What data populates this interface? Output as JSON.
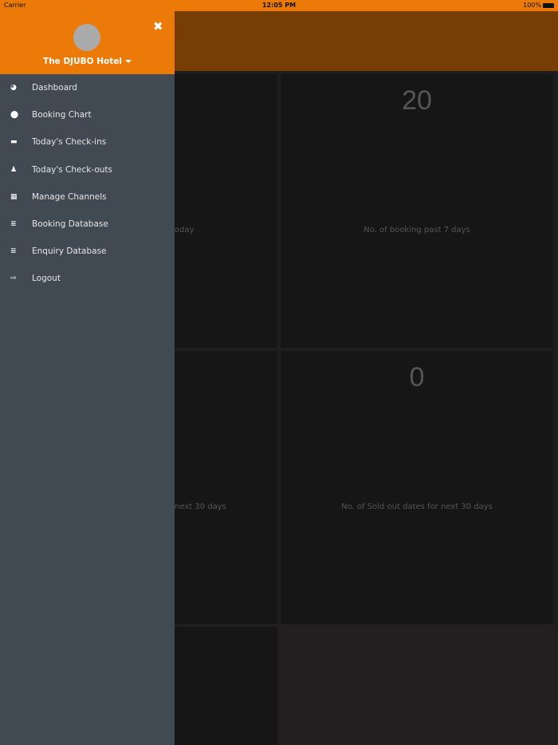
{
  "status_bar": {
    "carrier": "Carrier",
    "time": "12:05 PM",
    "battery": "100%"
  },
  "drawer": {
    "hotel_name": "The DJUBO Hotel",
    "menu": [
      {
        "label": "Dashboard",
        "icon": "dashboard-icon",
        "glyph": "◕"
      },
      {
        "label": "Booking Chart",
        "icon": "map-marker-icon",
        "glyph": "⬤"
      },
      {
        "label": "Today's Check-ins",
        "icon": "bed-icon",
        "glyph": "▬"
      },
      {
        "label": "Today's Check-outs",
        "icon": "person-icon",
        "glyph": "♟"
      },
      {
        "label": "Manage Channels",
        "icon": "grid-icon",
        "glyph": "▦"
      },
      {
        "label": "Booking Database",
        "icon": "database-icon",
        "glyph": "≣"
      },
      {
        "label": "Enquiry Database",
        "icon": "database-icon",
        "glyph": "≣"
      },
      {
        "label": "Logout",
        "icon": "sign-out-icon",
        "glyph": "⇨"
      }
    ]
  },
  "dashboard": {
    "cards": [
      {
        "value": "20",
        "label": "No. of booking past 7 days"
      },
      {
        "value": "0",
        "label": "No. of Sold out dates for next 30 days"
      }
    ],
    "partial_labels": [
      "oday",
      "next 30 days"
    ]
  }
}
